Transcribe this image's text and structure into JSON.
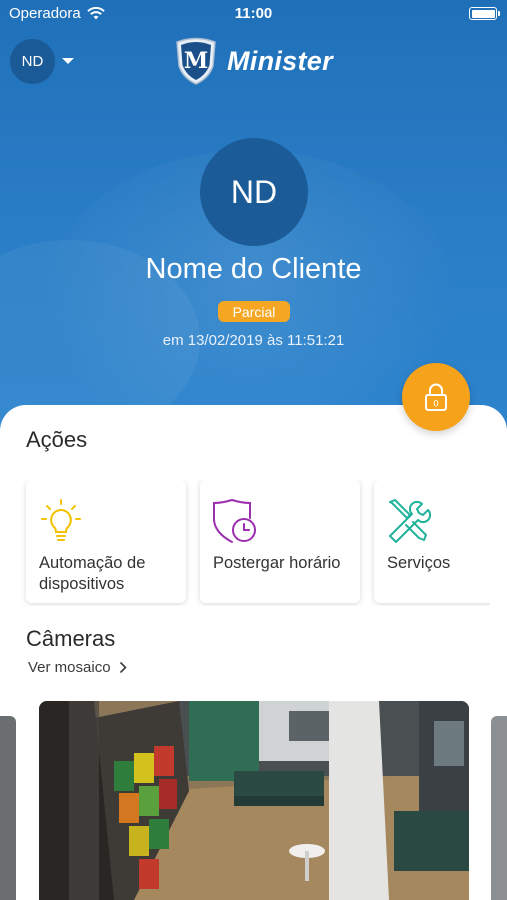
{
  "status_bar": {
    "carrier": "Operadora",
    "time": "11:00"
  },
  "header": {
    "user_initials": "ND",
    "logo_text": "Minister",
    "logo_mark": "M"
  },
  "profile": {
    "initials": "ND",
    "client_name": "Nome do Cliente",
    "status_badge": "Parcial",
    "timestamp": "em 13/02/2019 às 11:51:21",
    "lock_count": "0"
  },
  "actions": {
    "title": "Ações",
    "items": [
      {
        "label": "Automação de dispositivos",
        "icon": "lightbulb-icon",
        "color": "#f2c200"
      },
      {
        "label": "Postergar horário",
        "icon": "shield-clock-icon",
        "color": "#9b2fae"
      },
      {
        "label": "Serviços",
        "icon": "tools-icon",
        "color": "#1fb39b"
      }
    ]
  },
  "cameras": {
    "title": "Câmeras",
    "mosaic_link": "Ver mosaico"
  },
  "colors": {
    "brand_blue": "#2a7ec7",
    "accent_orange": "#f7a21b",
    "badge_orange": "#f5a623"
  }
}
